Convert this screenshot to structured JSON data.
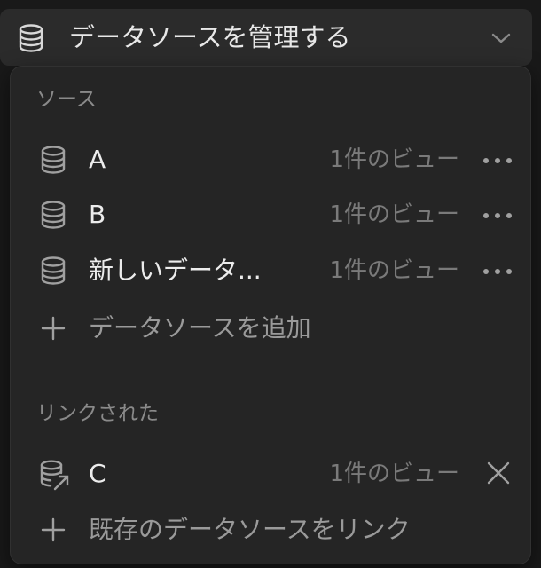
{
  "header": {
    "title": "データソースを管理する",
    "icon": "database-icon",
    "chevron": "chevron-down-icon"
  },
  "sources": {
    "label": "ソース",
    "items": [
      {
        "name": "A",
        "views": "1件のビュー"
      },
      {
        "name": "B",
        "views": "1件のビュー"
      },
      {
        "name": "新しいデータ...",
        "views": "1件のビュー"
      }
    ],
    "add_label": "データソースを追加"
  },
  "linked": {
    "label": "リンクされた",
    "items": [
      {
        "name": "C",
        "views": "1件のビュー"
      }
    ],
    "link_label": "既存のデータソースをリンク"
  },
  "colors": {
    "background": "#191919",
    "panel": "#252525",
    "header": "#2b2b2b",
    "text": "#ececec",
    "muted": "#7a7a7a"
  }
}
